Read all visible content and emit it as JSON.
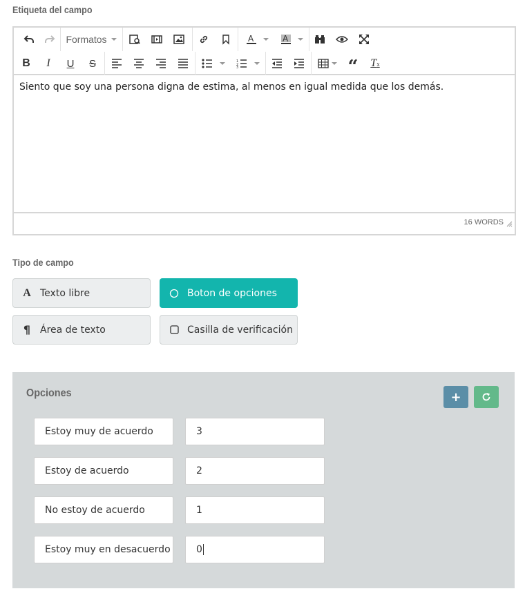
{
  "field_label": {
    "title": "Etiqueta del campo",
    "editor": {
      "formats_label": "Formatos",
      "content": "Siento que soy una persona digna de estima, al menos en igual medida que los demás.",
      "word_count": "16 WORDS"
    }
  },
  "field_type": {
    "title": "Tipo de campo",
    "options": [
      {
        "label": "Texto libre",
        "icon": "letter-a-icon",
        "active": false
      },
      {
        "label": "Boton de opciones",
        "icon": "radio-circle-icon",
        "active": true
      },
      {
        "label": "Área de texto",
        "icon": "pilcrow-icon",
        "active": false
      },
      {
        "label": "Casilla de verificación",
        "icon": "checkbox-square-icon",
        "active": false
      }
    ]
  },
  "options_panel": {
    "title": "Opciones",
    "add_button": "+",
    "refresh_icon": "refresh-icon",
    "rows": [
      {
        "label": "Estoy muy de acuerdo",
        "value": "3"
      },
      {
        "label": "Estoy de acuerdo",
        "value": "2"
      },
      {
        "label": "No estoy de acuerdo",
        "value": "1"
      },
      {
        "label": "Estoy muy en desacuerdo",
        "value": "0"
      }
    ]
  },
  "colors": {
    "active_type": "#13b5ad",
    "add_button": "#5b8ea7",
    "refresh_button": "#63b98a",
    "panel_bg": "#d5d9da"
  }
}
